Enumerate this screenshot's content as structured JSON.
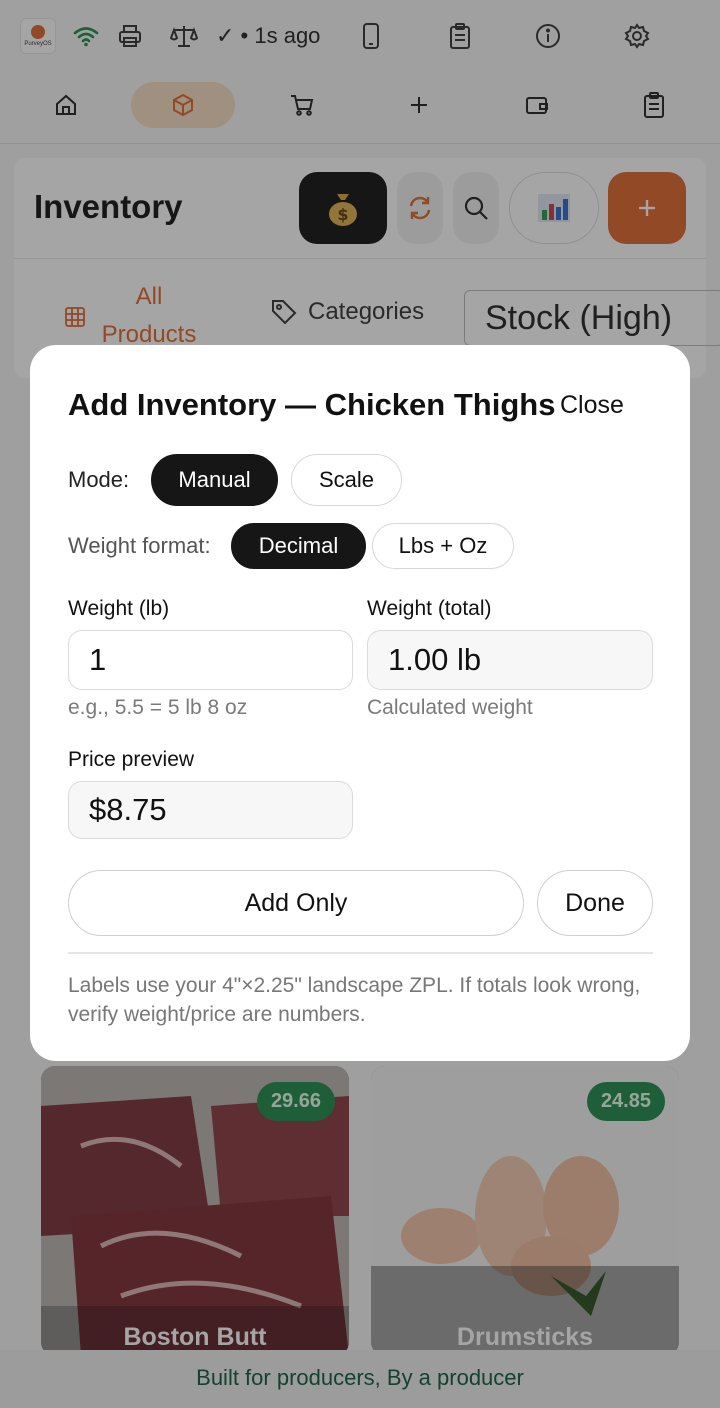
{
  "status": {
    "logo_text": "PurveyOS",
    "sync_text": "✓ • 1s ago"
  },
  "inventory": {
    "title": "Inventory",
    "tabs": {
      "all": "All Products",
      "categories": "Categories"
    },
    "sort_value": "Stock (High)"
  },
  "modal": {
    "title": "Add Inventory — Chicken Thighs",
    "close_label": "Close",
    "mode_label": "Mode:",
    "mode_options": [
      "Manual",
      "Scale"
    ],
    "weight_format_label": "Weight format:",
    "weight_format_options": [
      "Decimal",
      "Lbs + Oz"
    ],
    "weight_lb_label": "Weight (lb)",
    "weight_lb_value": "1",
    "weight_lb_hint": "e.g., 5.5 = 5 lb 8 oz",
    "weight_total_label": "Weight (total)",
    "weight_total_value": "1.00 lb",
    "weight_total_hint": "Calculated weight",
    "price_label": "Price preview",
    "price_value": "$8.75",
    "add_only_label": "Add Only",
    "done_label": "Done",
    "note": "Labels use your 4\"×2.25\" landscape ZPL. If totals look wrong, verify weight/price are numbers."
  },
  "products": [
    {
      "name": "Boston Butt",
      "stock": "29.66"
    },
    {
      "name": "Drumsticks",
      "stock": "24.85"
    }
  ],
  "footer": {
    "tagline": "Built for producers, By a producer"
  },
  "colors": {
    "accent": "#e0662a",
    "badge": "#1f8a4c",
    "footer_text": "#0f5a3d"
  }
}
